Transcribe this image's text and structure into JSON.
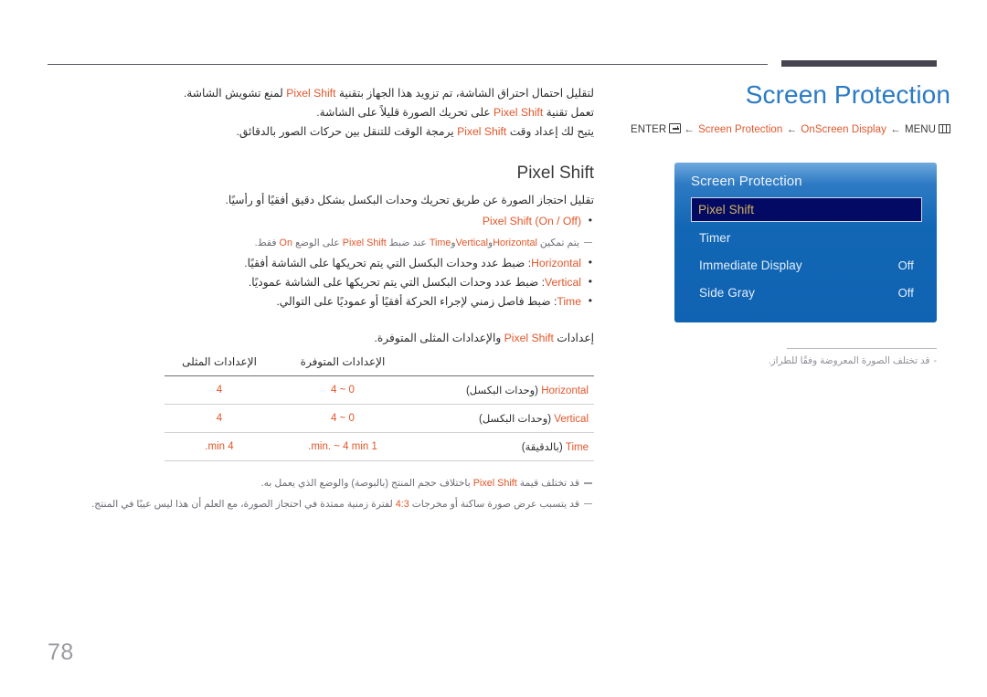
{
  "page": {
    "number": "78"
  },
  "header": {
    "title": "Screen Protection",
    "breadcrumb": {
      "enter_label": "ENTER",
      "enter_icon": "enter-key-icon",
      "arrow": "←",
      "item1": "Screen Protection",
      "item2": "OnScreen Display",
      "menu_label": "MENU",
      "menu_icon": "menu-bars-icon"
    }
  },
  "osd": {
    "title": "Screen Protection",
    "rows": [
      {
        "label": "Pixel Shift",
        "value": "",
        "selected": true
      },
      {
        "label": "Timer",
        "value": "",
        "selected": false
      },
      {
        "label": "Immediate Display",
        "value": "Off",
        "selected": false
      },
      {
        "label": "Side Gray",
        "value": "Off",
        "selected": false
      }
    ]
  },
  "right_note": {
    "dash": "-",
    "text": "قد تختلف الصورة المعروضة وفقًا للطراز."
  },
  "intro": {
    "line1_a": "لتقليل احتمال احتراق الشاشة، تم تزويد هذا الجهاز بتقنية",
    "kw": "Pixel Shift",
    "line1_b": "لمنع تشويش الشاشة.",
    "line2_a": "تعمل تقنية",
    "line2_b": "على تحريك الصورة قليلاً على الشاشة.",
    "line3_a": "يتيح لك إعداد وقت",
    "line3_b": "يرمجة الوقت للتنقل بين حركات الصور بالدقائق."
  },
  "section": {
    "title": "Pixel Shift",
    "desc": "تقليل احتجاز الصورة عن طريق تحريك وحدات البكسل بشكل دقيق أفقيًا أو رأسيًا.",
    "bullet0": "Pixel Shift (On / Off)",
    "note0": {
      "a": "يتم تمكين",
      "kw1": "Horizontal",
      "b": "و",
      "kw2": "Vertical",
      "c": "و",
      "kw3": "Time",
      "d": "عند ضبط",
      "kw4": "Pixel Shift",
      "e": "على الوضع",
      "kw5": "On",
      "f": "فقط."
    },
    "bullets": [
      {
        "kw": "Horizontal",
        "text": ": ضبط عدد وحدات البكسل التي يتم تحريكها على الشاشة أفقيًا."
      },
      {
        "kw": "Vertical",
        "text": ": ضبط عدد وحدات البكسل التي يتم تحريكها على الشاشة عموديًا."
      },
      {
        "kw": "Time",
        "text": ": ضبط فاصل زمني لإجراء الحركة أفقيًا أو عموديًا على التوالي."
      }
    ]
  },
  "table": {
    "caption_a": "إعدادات",
    "caption_kw": "Pixel Shift",
    "caption_b": "والإعدادات المثلى المتوفرة.",
    "headers": {
      "name": "",
      "available": "الإعدادات المتوفرة",
      "optimum": "الإعدادات المثلى"
    },
    "rows": [
      {
        "kw": "Horizontal",
        "unit": " (وحدات البكسل)",
        "available": "0 ~ 4",
        "optimum": "4"
      },
      {
        "kw": "Vertical",
        "unit": " (وحدات البكسل)",
        "available": "0 ~ 4",
        "optimum": "4"
      },
      {
        "kw": "Time",
        "unit": " (بالدقيقة)",
        "available": "1 min. ~ 4 min.",
        "optimum": "4 min."
      }
    ]
  },
  "bottom_notes": {
    "note1": {
      "a": "قد تختلف قيمة",
      "kw": "Pixel Shift",
      "b": "باختلاف حجم المنتج (بالبوصة) والوضع الذي يعمل به."
    },
    "note2": {
      "a": "قد يتسبب عرض صورة ساكنة أو مخرجات",
      "kw": "4:3",
      "b": "لفترة زمنية ممتدة في احتجاز الصورة، مع العلم أن هذا ليس عيبًا في المنتج."
    }
  },
  "colors": {
    "accent_orange": "#e2562a",
    "title_blue": "#2a7ac4",
    "osd_blue": "#0f63b2",
    "osd_selected": "#020a63",
    "osd_selected_text": "#d6b45e"
  }
}
